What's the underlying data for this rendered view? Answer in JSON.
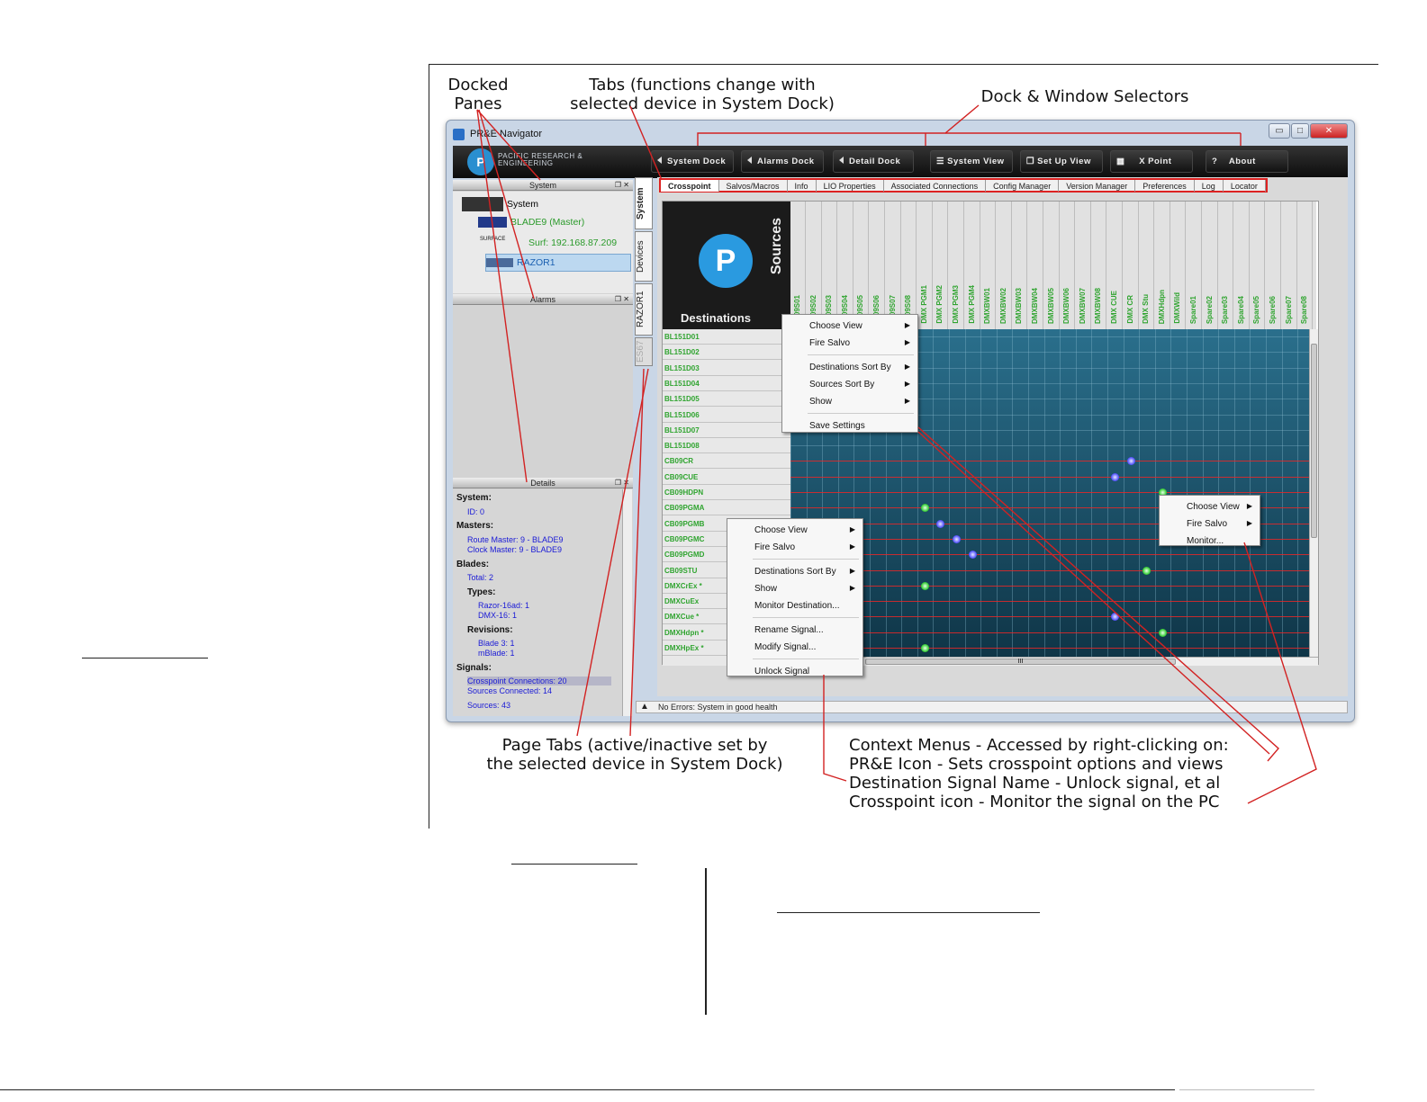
{
  "callouts": {
    "docked_panes": [
      "Docked",
      "Panes"
    ],
    "tabs": [
      "Tabs (functions change with",
      "selected device in System Dock)"
    ],
    "dock_window": "Dock & Window Selectors",
    "page_tabs": [
      "Page Tabs (active/inactive set by",
      "the selected device in System Dock)"
    ],
    "context_menus": [
      "Context Menus - Accessed by right-clicking on:",
      "PR&E Icon - Sets crosspoint options and views",
      "Destination Signal Name - Unlock signal, et al",
      "Crosspoint icon  - Monitor the signal on the PC"
    ]
  },
  "window": {
    "title": "PR&E Navigator",
    "min": "▭",
    "max": "□",
    "close": "✕"
  },
  "toolbar": {
    "logo": "P",
    "brand": [
      "PACIFIC RESEARCH &",
      "ENGINEERING"
    ],
    "buttons": [
      "System Dock",
      "Alarms Dock",
      "Detail Dock",
      "System View",
      "Set Up View",
      "X Point",
      "About"
    ]
  },
  "system_pane": {
    "title": "System",
    "pin": "❐ ✕",
    "items": [
      "System",
      "BLADE9 (Master)",
      "Surf: 192.168.87.209",
      "RAZOR1"
    ],
    "surface_label": "SURFACE"
  },
  "alarms_pane": {
    "title": "Alarms",
    "pin": "❐ ✕"
  },
  "details_pane": {
    "title": "Details",
    "pin": "❐ ✕",
    "lines": [
      {
        "t": "System:",
        "k": "h",
        "i": 0
      },
      {
        "t": "ID: 0",
        "k": "v",
        "i": 1
      },
      {
        "t": "Masters:",
        "k": "h",
        "i": 0
      },
      {
        "t": "Route Master: 9 - BLADE9",
        "k": "v",
        "i": 1
      },
      {
        "t": "Clock Master: 9 - BLADE9",
        "k": "v",
        "i": 1
      },
      {
        "t": "Blades:",
        "k": "h",
        "i": 0
      },
      {
        "t": "Total: 2",
        "k": "v",
        "i": 1
      },
      {
        "t": "Types:",
        "k": "h",
        "i": 1
      },
      {
        "t": "Razor-16ad: 1",
        "k": "v",
        "i": 2
      },
      {
        "t": "DMX-16: 1",
        "k": "v",
        "i": 2
      },
      {
        "t": "Revisions:",
        "k": "h",
        "i": 1
      },
      {
        "t": "Blade 3: 1",
        "k": "v",
        "i": 2
      },
      {
        "t": "mBlade: 1",
        "k": "v",
        "i": 2
      },
      {
        "t": "Signals:",
        "k": "h",
        "i": 0
      },
      {
        "t": "Crosspoint Connections: 20",
        "k": "v",
        "i": 1
      },
      {
        "t": "Sources Connected: 14",
        "k": "v",
        "i": 1
      },
      {
        "t": "Sources: 43",
        "k": "v",
        "i": 1
      }
    ]
  },
  "page_tabs": [
    "System",
    "Devices",
    "RAZOR1",
    "ES67"
  ],
  "tabs": [
    "Crosspoint",
    "Salvos/Macros",
    "Info",
    "LIO Properties",
    "Associated Connections",
    "Config Manager",
    "Version Manager",
    "Preferences",
    "Log",
    "Locator"
  ],
  "crosspoint": {
    "sources_label": "Sources",
    "destinations_label": "Destinations",
    "sources": [
      "L009S01",
      "L009S02",
      "L009S03",
      "L009S04",
      "L009S05",
      "L009S06",
      "L009S07",
      "L009S08",
      "DMX PGM1",
      "DMX PGM2",
      "DMX PGM3",
      "DMX PGM4",
      "DMXBW01",
      "DMXBW02",
      "DMXBW03",
      "DMXBW04",
      "DMXBW05",
      "DMXBW06",
      "DMXBW07",
      "DMXBW08",
      "DMX CUE",
      "DMX CR",
      "DMX Stu",
      "DMXHdpn",
      "DMXWild",
      "Spare01",
      "Spare02",
      "Spare03",
      "Spare04",
      "Spare05",
      "Spare06",
      "Spare07",
      "Spare08"
    ],
    "destinations": [
      "BL151D01",
      "BL151D02",
      "BL151D03",
      "BL151D04",
      "BL151D05",
      "BL151D06",
      "BL151D07",
      "BL151D08",
      "CB09CR",
      "CB09CUE",
      "CB09HDPN",
      "CB09PGMA",
      "CB09PGMB",
      "CB09PGMC",
      "CB09PGMD",
      "CB09STU",
      "DMXCrEx *",
      "DMXCuEx",
      "DMXCue *",
      "DMXHdpn *",
      "DMXHpEx *"
    ],
    "scroll_grip": "III"
  },
  "menu_icon": {
    "items": [
      "Choose View",
      "Fire Salvo",
      "Destinations Sort By",
      "Sources Sort By",
      "Show",
      "Save Settings"
    ]
  },
  "menu_dest": {
    "items": [
      "Choose View",
      "Fire Salvo",
      "Destinations Sort By",
      "Show",
      "Monitor Destination...",
      "Rename Signal...",
      "Modify Signal...",
      "Unlock Signal"
    ]
  },
  "menu_xpt": {
    "items": [
      "Choose View",
      "Fire Salvo",
      "Monitor..."
    ]
  },
  "submenu_arrow": "▶",
  "status": {
    "text": "No Errors: System in good health",
    "icon": "▲"
  },
  "colors": {
    "accent_red": "#d22222",
    "source_green": "#2fa42f",
    "grid_blue": "#1f5a74"
  }
}
